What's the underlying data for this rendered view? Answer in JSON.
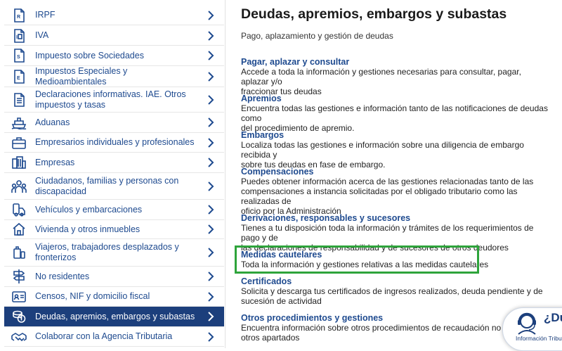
{
  "sidebar": {
    "items": [
      {
        "label": "IRPF",
        "icon": "document-r-icon"
      },
      {
        "label": "IVA",
        "icon": "document-iva-icon"
      },
      {
        "label": "Impuesto sobre Sociedades",
        "icon": "document-s-icon"
      },
      {
        "label": "Impuestos Especiales y Medioambientales",
        "icon": "document-e-icon"
      },
      {
        "label": "Declaraciones informativas. IAE. Otros impuestos y tasas",
        "icon": "document-list-icon"
      },
      {
        "label": "Aduanas",
        "icon": "ship-icon"
      },
      {
        "label": "Empresarios individuales y profesionales",
        "icon": "briefcase-icon"
      },
      {
        "label": "Empresas",
        "icon": "building-icon"
      },
      {
        "label": "Ciudadanos, familias y personas con discapacidad",
        "icon": "people-icon"
      },
      {
        "label": "Vehículos y embarcaciones",
        "icon": "car-icon"
      },
      {
        "label": "Vivienda y otros inmuebles",
        "icon": "house-icon"
      },
      {
        "label": "Viajeros, trabajadores desplazados y fronterizos",
        "icon": "luggage-icon"
      },
      {
        "label": "No residentes",
        "icon": "signpost-icon"
      },
      {
        "label": "Censos, NIF y domicilio fiscal",
        "icon": "id-card-icon"
      },
      {
        "label": "Deudas, apremios, embargos y subastas",
        "icon": "coins-icon"
      },
      {
        "label": "Colaborar con la Agencia Tributaria",
        "icon": "handshake-icon"
      }
    ]
  },
  "main": {
    "title": "Deudas, apremios, embargos y subastas",
    "subtitle": "Pago, aplazamiento y gestión de deudas",
    "sections": [
      {
        "heading": "Pagar, aplazar y consultar",
        "lines": [
          "Accede a toda la información y gestiones necesarias para consultar, pagar, aplazar y/o",
          "fraccionar tus deudas"
        ]
      },
      {
        "heading": "Apremios",
        "lines": [
          "Encuentra todas las gestiones e información tanto de las notificaciones de deudas como",
          "del procedimiento de apremio."
        ]
      },
      {
        "heading": "Embargos",
        "lines": [
          "Localiza todas las gestiones e información sobre una diligencia de embargo recibida y",
          "sobre tus deudas en fase de embargo."
        ]
      },
      {
        "heading": "Compensaciones",
        "lines": [
          "Puedes obtener información acerca de las gestiones relacionadas tanto de las",
          "compensaciones a instancia solicitadas por el obligado tributario como las realizadas de",
          "oficio por la Administración"
        ]
      },
      {
        "heading": "Derivaciones, responsables y sucesores",
        "lines": [
          "Tienes a tu disposición toda la información y trámites de los requerimientos de pago y de",
          "las declaraciones de responsabilidad y de sucesores de otros deudores"
        ]
      },
      {
        "heading": "Medidas cautelares",
        "lines": [
          "Toda la información y gestiones relativas a las medidas cautelares"
        ]
      },
      {
        "heading": "Certificados",
        "lines": [
          "Solicita y descarga tus certificados de ingresos realizados, deuda pendiente y de",
          "sucesión de actividad"
        ]
      },
      {
        "heading": "Otros procedimientos y gestiones",
        "lines": [
          "Encuentra información sobre otros procedimientos de recaudación no encu",
          "otros apartados"
        ]
      }
    ]
  },
  "help": {
    "title": "¿Du",
    "subtitle": "Información Tributa"
  },
  "colors": {
    "brand": "#1c3f7c",
    "link": "#1e4a8f",
    "highlight": "#2ea43b"
  }
}
